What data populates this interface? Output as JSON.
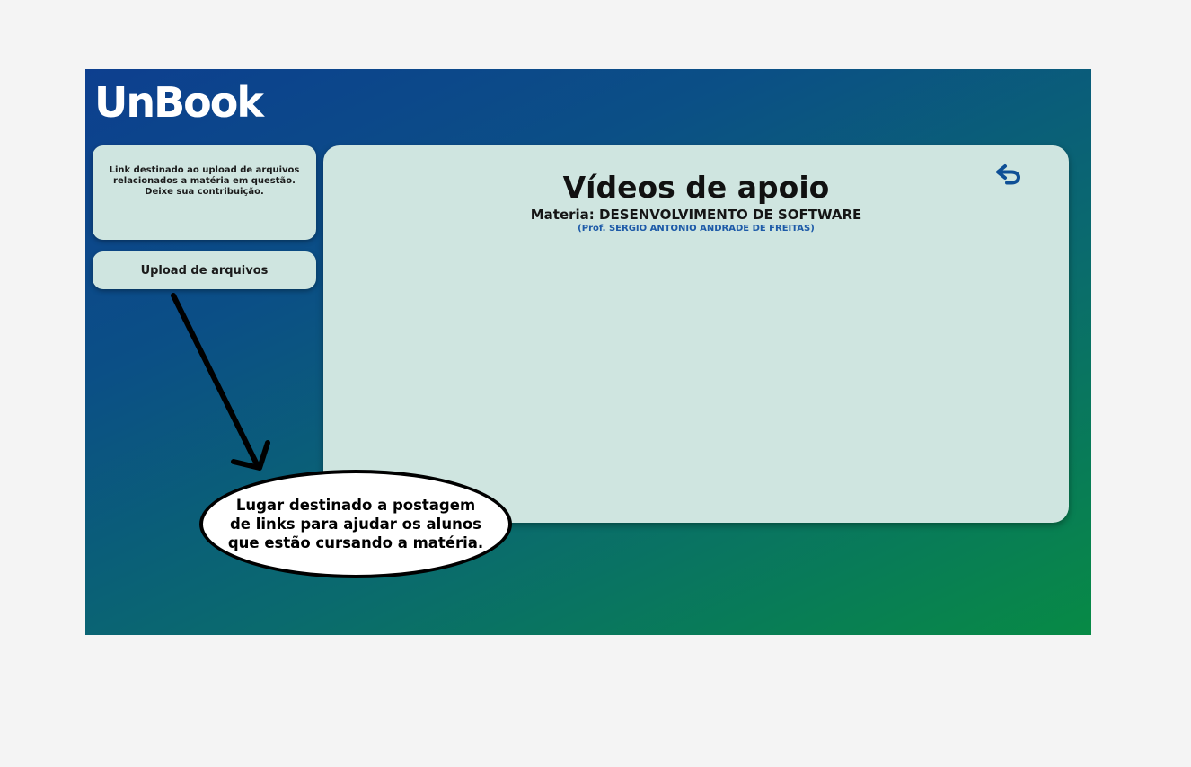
{
  "app": {
    "logo_text": "UnBook"
  },
  "sidebar": {
    "info_text": "Link destinado ao upload de arquivos relacionados a matéria em questão. Deixe sua contribuição.",
    "upload_label": "Upload de arquivos"
  },
  "main": {
    "title": "Vídeos de apoio",
    "subject": "Materia: DESENVOLVIMENTO DE SOFTWARE",
    "professor": "(Prof. SERGIO ANTONIO ANDRADE DE FREITAS)",
    "back_icon": "undo-arrow-icon"
  },
  "annotation": {
    "callout_text": "Lugar destinado a postagem de links para ajudar os alunos que estão cursando a matéria.",
    "arrow_icon": "arrow-down-icon"
  },
  "colors": {
    "gradient_start": "#0d3f8f",
    "gradient_end": "#078a45",
    "panel_bg": "#cfe5e0",
    "accent_blue": "#1d5aa8"
  }
}
